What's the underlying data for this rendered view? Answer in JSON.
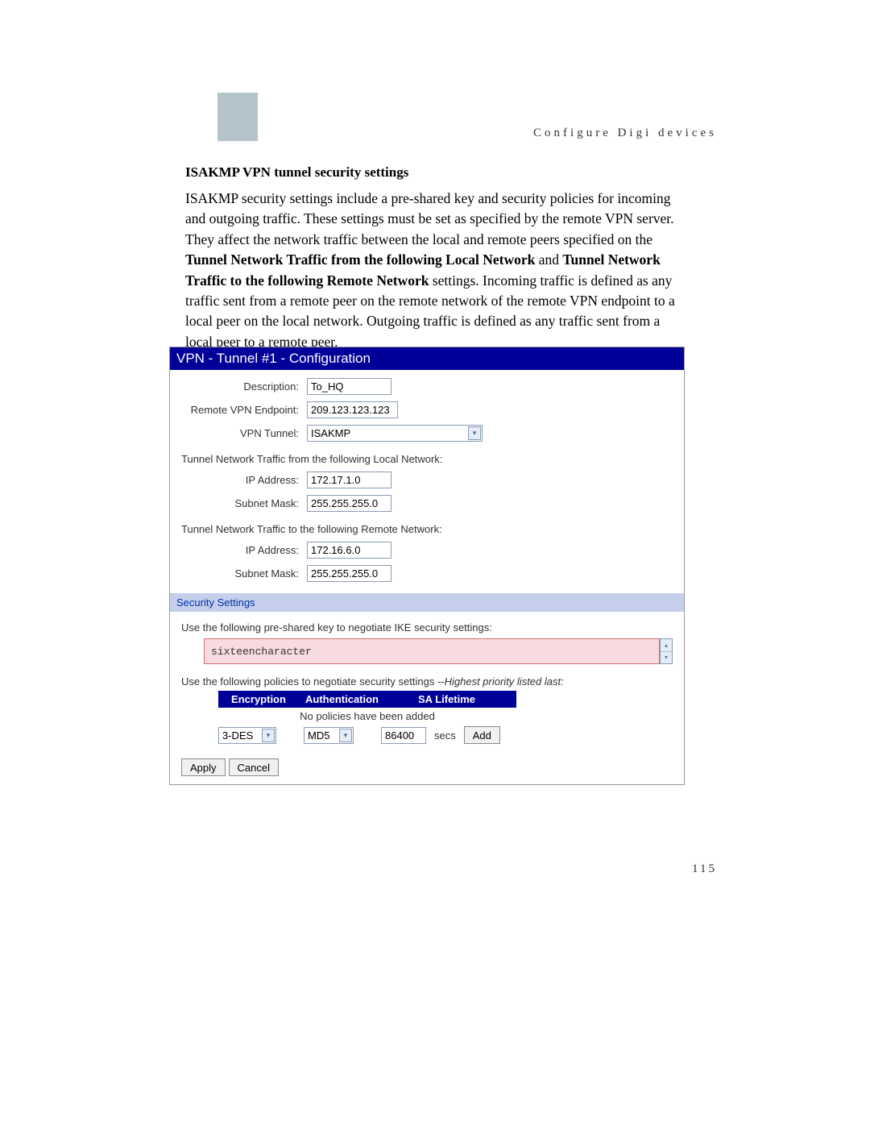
{
  "header_text": "Configure Digi devices",
  "section_title": "ISAKMP VPN tunnel security settings",
  "body_text_parts": {
    "p1": "ISAKMP security settings include a pre-shared key and security policies for incoming and outgoing traffic. These settings must be set as specified by the remote VPN server. They affect the network traffic between the local and remote peers specified on the ",
    "b1": "Tunnel Network Traffic from the following Local Network",
    "p2": " and ",
    "b2": "Tunnel Network Traffic to the following Remote Network",
    "p3": " settings. Incoming traffic is defined as any traffic sent from a remote peer on the remote network of the remote VPN endpoint to a local peer on the local network. Outgoing traffic is defined as any traffic sent from a local peer to a remote peer."
  },
  "panel": {
    "title": "VPN - Tunnel #1 - Configuration",
    "fields": {
      "description_label": "Description:",
      "description_value": "To_HQ",
      "remote_endpoint_label": "Remote VPN Endpoint:",
      "remote_endpoint_value": "209.123.123.123",
      "vpn_tunnel_label": "VPN Tunnel:",
      "vpn_tunnel_value": "ISAKMP"
    },
    "local_network": {
      "heading": "Tunnel Network Traffic from the following Local Network:",
      "ip_label": "IP Address:",
      "ip_value": "172.17.1.0",
      "mask_label": "Subnet Mask:",
      "mask_value": "255.255.255.0"
    },
    "remote_network": {
      "heading": "Tunnel Network Traffic to the following Remote Network:",
      "ip_label": "IP Address:",
      "ip_value": "172.16.6.0",
      "mask_label": "Subnet Mask:",
      "mask_value": "255.255.255.0"
    },
    "security": {
      "heading": "Security Settings",
      "psk_label": "Use the following pre-shared key to negotiate IKE security settings:",
      "psk_value": "sixteencharacter",
      "policy_label_plain": "Use the following policies to negotiate security settings --",
      "policy_label_italic": "Highest priority listed last:",
      "table_headers": {
        "enc": "Encryption",
        "auth": "Authentication",
        "sa": "SA Lifetime"
      },
      "no_policies": "No policies have been added",
      "enc_value": "3-DES",
      "auth_value": "MD5",
      "sa_value": "86400",
      "secs_label": "secs",
      "add_button": "Add"
    },
    "buttons": {
      "apply": "Apply",
      "cancel": "Cancel"
    }
  },
  "page_number": "115"
}
